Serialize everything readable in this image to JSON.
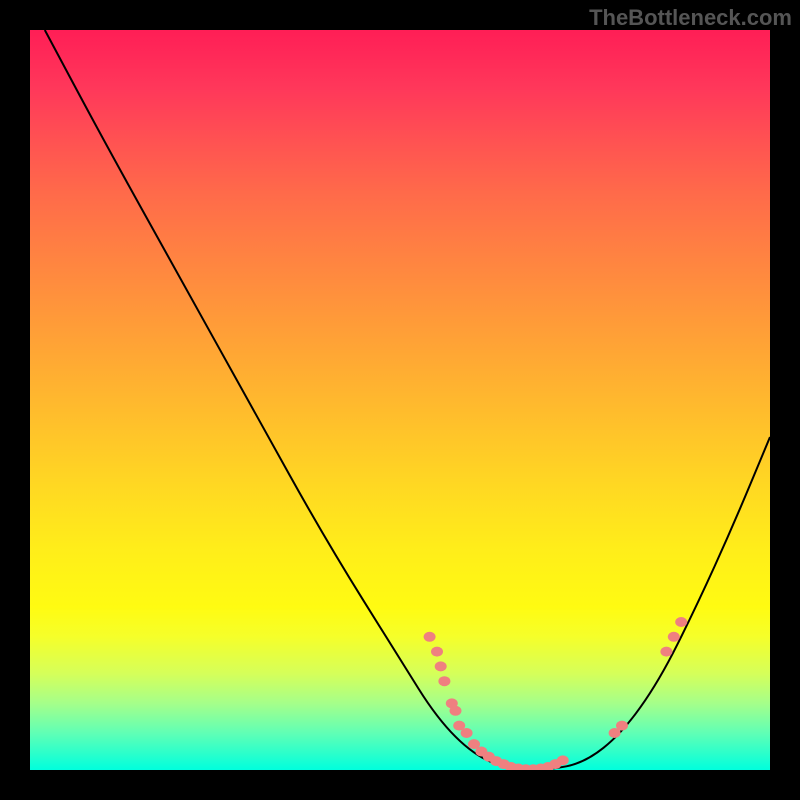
{
  "watermark": "TheBottleneck.com",
  "chart_data": {
    "type": "line",
    "title": "",
    "xlabel": "",
    "ylabel": "",
    "xlim": [
      0,
      100
    ],
    "ylim": [
      0,
      100
    ],
    "background_gradient": {
      "top": "#ff1e56",
      "bottom": "#00ffdd",
      "stops": [
        "#ff1e56",
        "#ff5252",
        "#ff8142",
        "#ffad32",
        "#ffd922",
        "#fffb12",
        "#60ffb5",
        "#00ffdd"
      ]
    },
    "curve": [
      {
        "x": 2,
        "y": 100
      },
      {
        "x": 10,
        "y": 85
      },
      {
        "x": 20,
        "y": 67
      },
      {
        "x": 30,
        "y": 49
      },
      {
        "x": 40,
        "y": 31
      },
      {
        "x": 50,
        "y": 15
      },
      {
        "x": 55,
        "y": 7
      },
      {
        "x": 60,
        "y": 2
      },
      {
        "x": 65,
        "y": 0
      },
      {
        "x": 70,
        "y": 0
      },
      {
        "x": 75,
        "y": 1
      },
      {
        "x": 80,
        "y": 5
      },
      {
        "x": 85,
        "y": 12
      },
      {
        "x": 90,
        "y": 22
      },
      {
        "x": 95,
        "y": 33
      },
      {
        "x": 100,
        "y": 45
      }
    ],
    "markers": [
      {
        "x": 54,
        "y": 18
      },
      {
        "x": 55,
        "y": 16
      },
      {
        "x": 55.5,
        "y": 14
      },
      {
        "x": 56,
        "y": 12
      },
      {
        "x": 57,
        "y": 9
      },
      {
        "x": 57.5,
        "y": 8
      },
      {
        "x": 58,
        "y": 6
      },
      {
        "x": 59,
        "y": 5
      },
      {
        "x": 60,
        "y": 3.5
      },
      {
        "x": 61,
        "y": 2.5
      },
      {
        "x": 62,
        "y": 1.8
      },
      {
        "x": 63,
        "y": 1.2
      },
      {
        "x": 64,
        "y": 0.8
      },
      {
        "x": 65,
        "y": 0.4
      },
      {
        "x": 66,
        "y": 0.2
      },
      {
        "x": 67,
        "y": 0.1
      },
      {
        "x": 68,
        "y": 0.1
      },
      {
        "x": 69,
        "y": 0.2
      },
      {
        "x": 70,
        "y": 0.4
      },
      {
        "x": 71,
        "y": 0.8
      },
      {
        "x": 72,
        "y": 1.3
      },
      {
        "x": 79,
        "y": 5
      },
      {
        "x": 80,
        "y": 6
      },
      {
        "x": 86,
        "y": 16
      },
      {
        "x": 87,
        "y": 18
      },
      {
        "x": 88,
        "y": 20
      }
    ],
    "marker_color": "#ef8080"
  }
}
